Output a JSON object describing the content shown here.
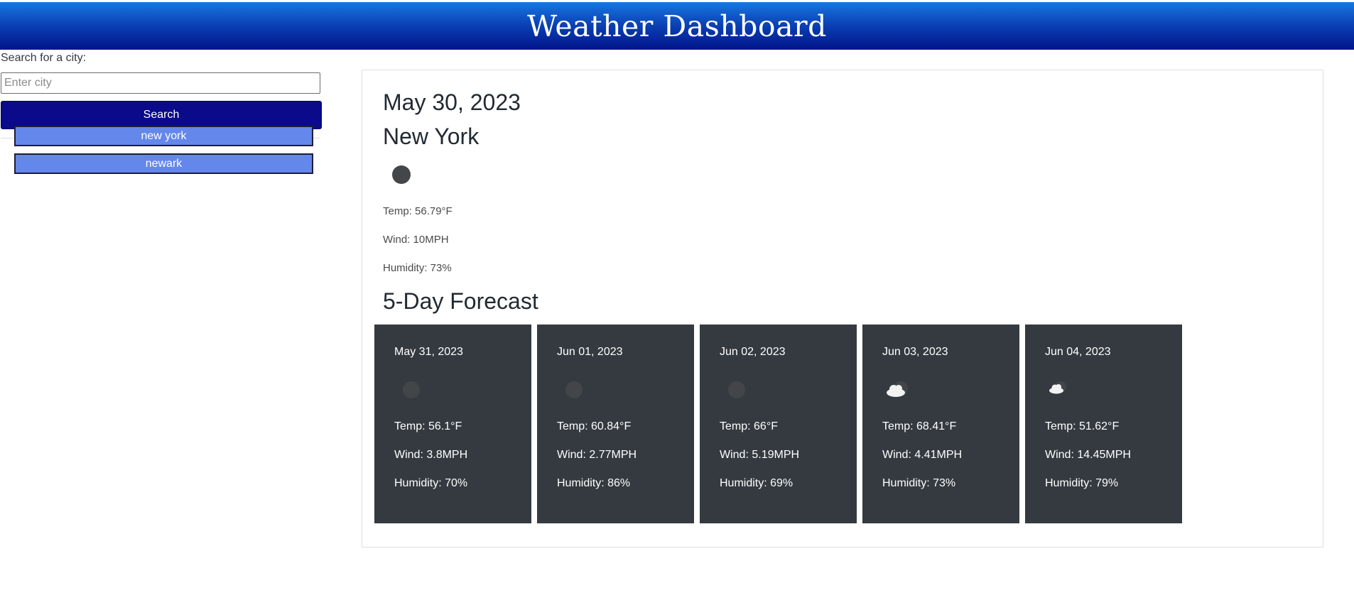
{
  "header": {
    "title": "Weather Dashboard"
  },
  "sidebar": {
    "search_label": "Search for a city:",
    "search_placeholder": "Enter city",
    "search_value": "",
    "search_button": "Search",
    "history": [
      {
        "label": "new york"
      },
      {
        "label": "newark"
      }
    ]
  },
  "current": {
    "date": "May 30, 2023",
    "city": "New York",
    "icon": "moon-icon",
    "temp": "Temp: 56.79°F",
    "wind": "Wind: 10MPH",
    "humidity": "Humidity: 73%"
  },
  "forecast": {
    "title": "5-Day Forecast",
    "days": [
      {
        "date": "May 31, 2023",
        "icon": "moon-icon",
        "temp": "Temp: 56.1°F",
        "wind": "Wind: 3.8MPH",
        "humidity": "Humidity: 70%"
      },
      {
        "date": "Jun 01, 2023",
        "icon": "moon-icon",
        "temp": "Temp: 60.84°F",
        "wind": "Wind: 2.77MPH",
        "humidity": "Humidity: 86%"
      },
      {
        "date": "Jun 02, 2023",
        "icon": "moon-icon",
        "temp": "Temp: 66°F",
        "wind": "Wind: 5.19MPH",
        "humidity": "Humidity: 69%"
      },
      {
        "date": "Jun 03, 2023",
        "icon": "cloud-moon-icon",
        "temp": "Temp: 68.41°F",
        "wind": "Wind: 4.41MPH",
        "humidity": "Humidity: 73%"
      },
      {
        "date": "Jun 04, 2023",
        "icon": "cloud-moon-icon",
        "temp": "Temp: 51.62°F",
        "wind": "Wind: 14.45MPH",
        "humidity": "Humidity: 79%"
      }
    ]
  },
  "colors": {
    "header_top": "#1877e0",
    "header_bottom": "#02148a",
    "search_button": "#0a0a8a",
    "history_button": "#6487eb",
    "card_bg": "#343a40"
  }
}
